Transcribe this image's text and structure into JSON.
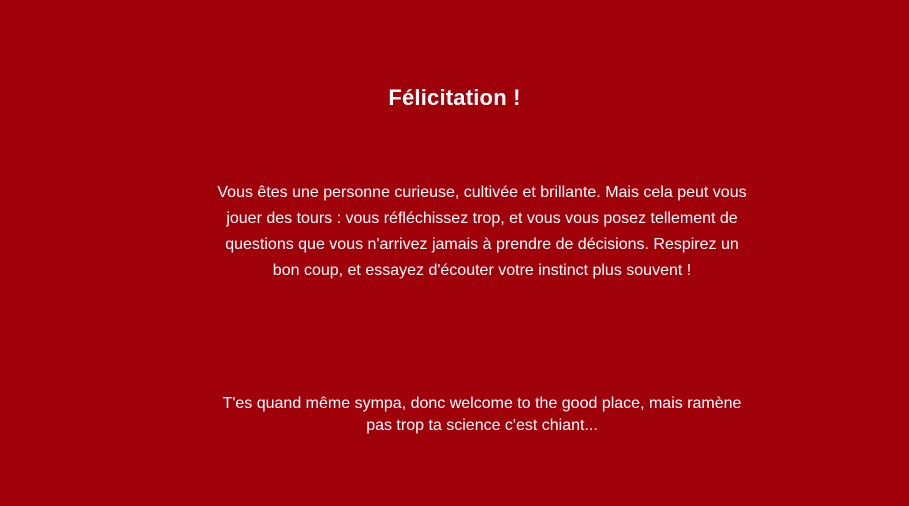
{
  "result": {
    "title": "Félicitation !",
    "message": "Vous êtes une personne curieuse, cultivée et brillante. Mais cela peut vous jouer des tours : vous réfléchissez trop, et vous vous posez tellement de questions que vous n'arrivez jamais à prendre de décisions. Respirez un bon coup, et essayez d'écouter votre instinct plus souvent !",
    "footer_note": "T'es quand même sympa, donc welcome to the good place, mais ramène pas trop ta science c'est chiant..."
  },
  "colors": {
    "background": "#a0000a",
    "text": "#ffffff"
  }
}
